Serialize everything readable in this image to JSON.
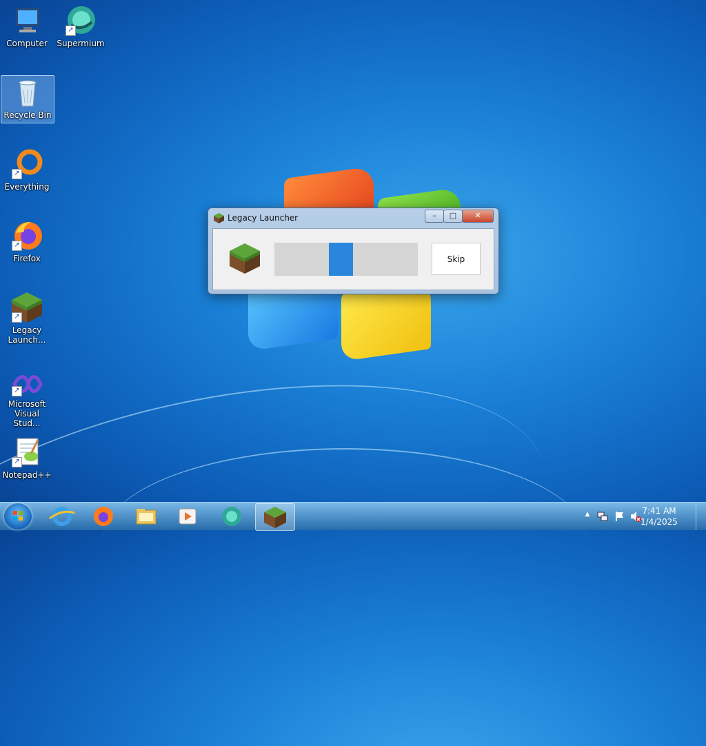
{
  "desktop": {
    "icons": [
      {
        "label": "Computer",
        "icon": "computer-icon"
      },
      {
        "label": "Supermium",
        "icon": "supermium-icon"
      },
      {
        "label": "Recycle Bin",
        "icon": "recycle-bin-icon"
      },
      {
        "label": "Everything",
        "icon": "everything-icon"
      },
      {
        "label": "Firefox",
        "icon": "firefox-icon"
      },
      {
        "label": "Legacy Launch...",
        "icon": "minecraft-grass-icon"
      },
      {
        "label": "Microsoft Visual Stud...",
        "icon": "visual-studio-icon"
      },
      {
        "label": "Notepad++",
        "icon": "notepadpp-icon"
      }
    ]
  },
  "dialog": {
    "title": "Legacy Launcher",
    "minimize": "–",
    "maximize": "□",
    "close": "✕",
    "skip_label": "Skip",
    "progress_color": "#2a86dd"
  },
  "taskbar": {
    "time": "7:41 AM",
    "date": "1/4/2025",
    "tray_arrow": "▲",
    "apps": [
      "internet-explorer-icon",
      "firefox-icon",
      "file-explorer-icon",
      "media-player-icon",
      "supermium-icon",
      "minecraft-grass-icon"
    ]
  }
}
